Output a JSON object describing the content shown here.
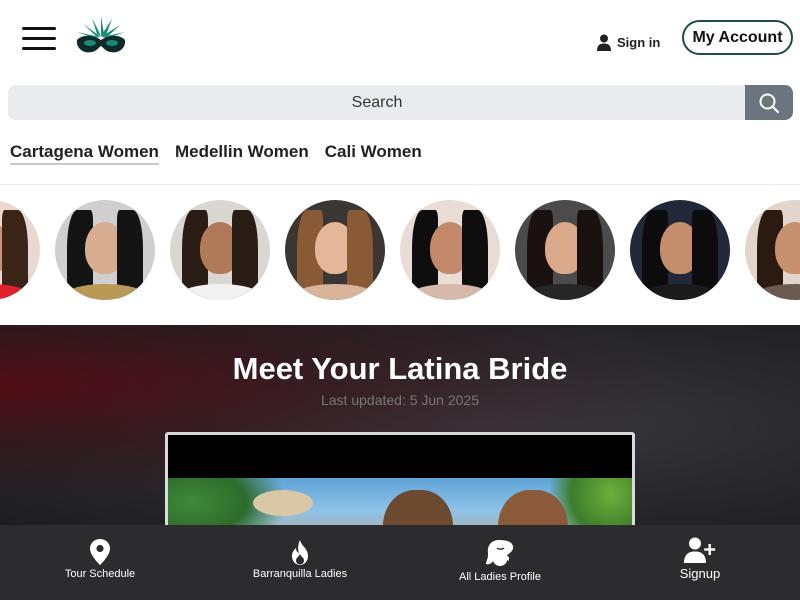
{
  "header": {
    "menu_icon": "hamburger-menu-icon",
    "logo_icon": "masquerade-mask-logo",
    "signin_label": "Sign in",
    "account_label": "My Account"
  },
  "search": {
    "placeholder": "Search",
    "icon": "search-icon"
  },
  "city_tabs": [
    {
      "label": "Cartagena Women",
      "active": true
    },
    {
      "label": "Medellin Women",
      "active": false
    },
    {
      "label": "Cali Women",
      "active": false
    }
  ],
  "profiles_count_visible": 8,
  "hero": {
    "title": "Meet Your Latina Bride",
    "updated": "Last updated: 5 Jun 2025"
  },
  "bottom_nav": [
    {
      "label": "Tour Schedule",
      "icon": "map-pin-icon"
    },
    {
      "label": "Barranquilla Ladies",
      "icon": "flame-icon"
    },
    {
      "label": "All Ladies Profile",
      "icon": "woman-silhouette-icon"
    },
    {
      "label": "Signup",
      "icon": "add-user-icon"
    }
  ],
  "colors": {
    "accent": "#1c4c47",
    "logo_green": "#1a7a6a",
    "search_button": "#6b7580",
    "nav_background": "#2c2c2e"
  }
}
